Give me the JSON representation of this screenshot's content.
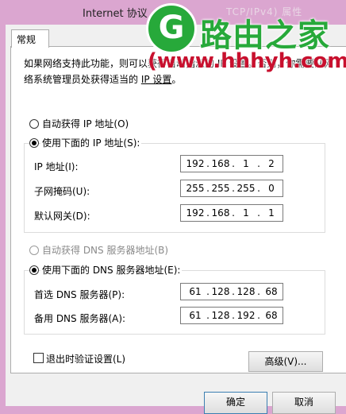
{
  "window": {
    "title": "Internet 协议",
    "title_ghost": "TCP/IPv4) 属性"
  },
  "tabs": [
    {
      "label": "常规"
    }
  ],
  "description": {
    "line1": "如果网络支持此功能，则可以获得自动指派的 IP 设置。否则，你需要从网",
    "line2_prefix": "络系统管理员处获得适当的 ",
    "line2_link": "IP 设置",
    "line2_suffix": "。"
  },
  "ip": {
    "auto_label": "自动获得 IP 地址(O)",
    "manual_label": "使用下面的 IP 地址(S):",
    "selected": "manual",
    "fields": [
      {
        "label": "IP 地址(I):",
        "octets": [
          "192",
          "168",
          "1",
          "2"
        ]
      },
      {
        "label": "子网掩码(U):",
        "octets": [
          "255",
          "255",
          "255",
          "0"
        ]
      },
      {
        "label": "默认网关(D):",
        "octets": [
          "192",
          "168",
          "1",
          "1"
        ]
      }
    ]
  },
  "dns": {
    "auto_label": "自动获得 DNS 服务器地址(B)",
    "manual_label": "使用下面的 DNS 服务器地址(E):",
    "selected": "manual",
    "fields": [
      {
        "label": "首选 DNS 服务器(P):",
        "octets": [
          "61",
          "128",
          "128",
          "68"
        ]
      },
      {
        "label": "备用 DNS 服务器(A):",
        "octets": [
          "61",
          "128",
          "192",
          "68"
        ]
      }
    ]
  },
  "validate_on_exit": {
    "label": "退出时验证设置(L)",
    "checked": false
  },
  "buttons": {
    "advanced": "高级(V)...",
    "ok": "确定",
    "cancel": "取消"
  },
  "watermark": {
    "logo_glyph": "G",
    "name": "路由之家",
    "url": "(www.hhhyh.com)"
  },
  "colors": {
    "page_bg": "#dba6d0",
    "watermark_green": "#27a93a",
    "watermark_red": "#c8102e"
  }
}
